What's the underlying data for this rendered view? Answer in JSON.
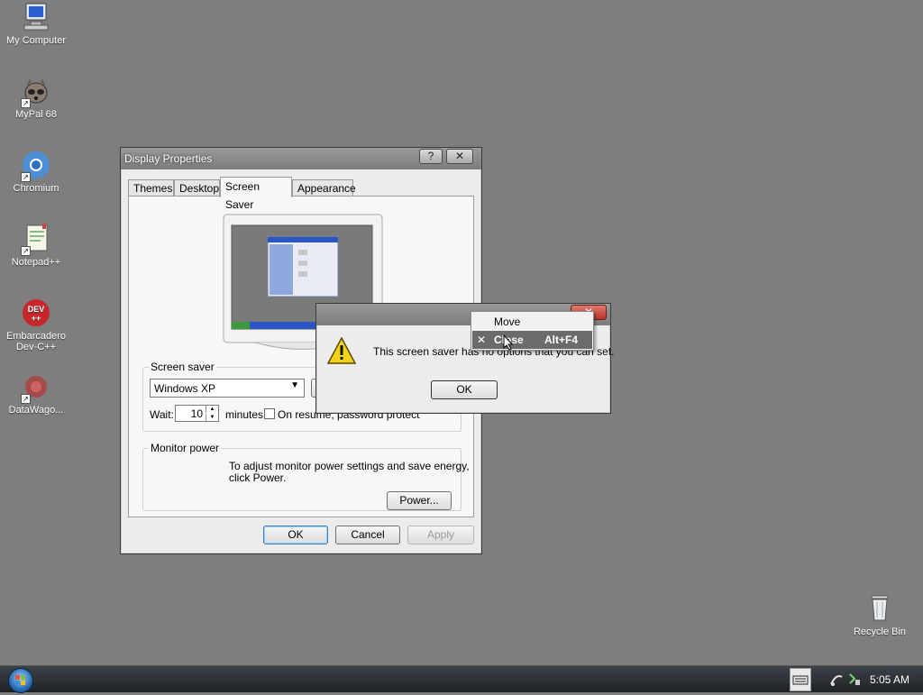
{
  "desktop": {
    "icons": [
      {
        "label": "My Computer",
        "icon": "my-computer-icon"
      },
      {
        "label": "MyPal 68",
        "icon": "mypal-icon"
      },
      {
        "label": "Chromium",
        "icon": "chromium-icon"
      },
      {
        "label": "Notepad++",
        "icon": "notepadpp-icon"
      },
      {
        "label_line1": "Embarcadero",
        "label_line2": "Dev-C++",
        "icon": "devcpp-icon",
        "badge": "DEV\n++"
      },
      {
        "label": "DataWago...",
        "icon": "datawagon-icon"
      }
    ],
    "recycle_bin": {
      "label": "Recycle Bin",
      "icon": "recycle-bin-icon"
    }
  },
  "display_properties": {
    "title": "Display Properties",
    "help_btn": "?",
    "close_btn": "✕",
    "tabs": [
      "Themes",
      "Desktop",
      "Screen Saver",
      "Appearance"
    ],
    "active_tab": "Screen Saver",
    "screen_saver": {
      "group_label": "Screen saver",
      "selected": "Windows XP",
      "wait_label": "Wait:",
      "wait_value": "10",
      "minutes_label": "minutes",
      "resume_label": "On resume, password protect",
      "resume_checked": false
    },
    "monitor_power": {
      "group_label": "Monitor power",
      "text_line1": "To adjust monitor power settings and save energy,",
      "text_line2": "click Power.",
      "power_btn": "Power..."
    },
    "buttons": {
      "ok": "OK",
      "cancel": "Cancel",
      "apply": "Apply"
    }
  },
  "message_box": {
    "message": "This screen saver has no options that you can set.",
    "ok": "OK",
    "icon": "warning-icon"
  },
  "context_menu": {
    "items": [
      {
        "label": "Move",
        "shortcut": ""
      },
      {
        "label": "Close",
        "shortcut": "Alt+F4",
        "highlighted": true
      }
    ]
  },
  "taskbar": {
    "clock": "5:05 AM"
  },
  "colors": {
    "desktop": "#7e7e7e",
    "highlight": "#6b6b6b",
    "close_red": "#c9473c",
    "warning_yellow": "#f4d21a"
  }
}
